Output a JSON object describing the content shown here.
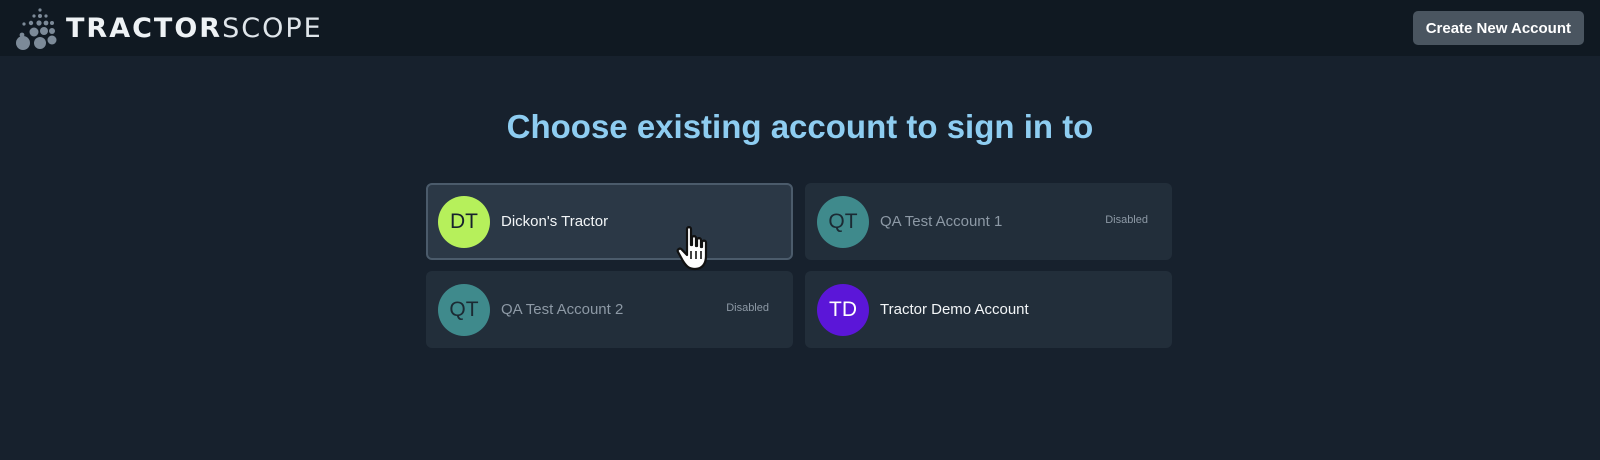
{
  "header": {
    "logo_bold": "TRACTOR",
    "logo_light": "SCOPE",
    "create_button_label": "Create New Account"
  },
  "main": {
    "heading": "Choose existing account to sign in to",
    "accounts": [
      {
        "initials": "DT",
        "name": "Dickon's Tractor",
        "badge": "",
        "avatar_color": "#b6f05b",
        "initials_color": "#17212d",
        "selected": true,
        "disabled": false
      },
      {
        "initials": "QT",
        "name": "QA Test Account 1",
        "badge": "Disabled",
        "avatar_color": "#3f8a8c",
        "initials_color": "#1b2a33",
        "selected": false,
        "disabled": true
      },
      {
        "initials": "QT",
        "name": "QA Test Account 2",
        "badge": "Disabled",
        "avatar_color": "#3f8a8c",
        "initials_color": "#1b2a33",
        "selected": false,
        "disabled": true
      },
      {
        "initials": "TD",
        "name": "Tractor Demo Account",
        "badge": "",
        "avatar_color": "#5b16d8",
        "initials_color": "#ffffff",
        "selected": false,
        "disabled": false
      }
    ]
  },
  "colors": {
    "background": "#17212d",
    "topbar": "#101922",
    "heading": "#8ecdf1",
    "card": "#222e3a",
    "card_selected": "#2b3846"
  }
}
